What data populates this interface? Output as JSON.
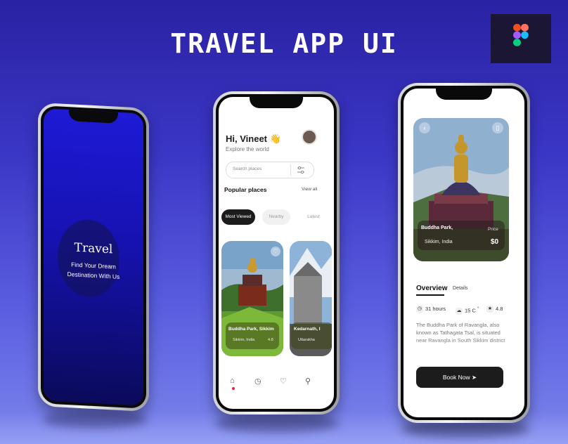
{
  "poster": {
    "title": "TRAVEL APP UI"
  },
  "splash": {
    "brand": "Travel",
    "tagline_line1": "Find Your Dream",
    "tagline_line2": "Destination With Us"
  },
  "home": {
    "greeting": "Hi, Vineet 👋",
    "subtitle": "Explore the world",
    "search_placeholder": "Search places",
    "section_title": "Popular places",
    "view_all": "View all",
    "tabs": [
      "Most Viewed",
      "Nearby",
      "Latest"
    ],
    "cards": [
      {
        "name": "Buddha Park, Sikkim",
        "location": "Sikkim, India",
        "rating": "4.8"
      },
      {
        "name": "Kedarnath, I",
        "location": "Uttarakha"
      }
    ],
    "nav_icons": [
      "home-icon",
      "clock-icon",
      "heart-icon",
      "profile-icon"
    ]
  },
  "detail": {
    "place_name": "Buddha Park,",
    "location": "Sikkim, India",
    "price_label": "Price",
    "price": "$0",
    "tabs": [
      "Overview",
      "Details"
    ],
    "stats": {
      "duration": "31 hours",
      "temp": "15 C",
      "deg": "°",
      "rating": "4.8"
    },
    "description": "The Buddha Park of Ravangla, also known as Tathagata Tsal, is situated near Ravangla in South Sikkim district",
    "cta": "Book Now"
  },
  "colors": {
    "accent": "#1c1c1c",
    "bg_top": "#2a21a3",
    "bg_bottom": "#7c86ec",
    "splash": "#1612b0"
  }
}
